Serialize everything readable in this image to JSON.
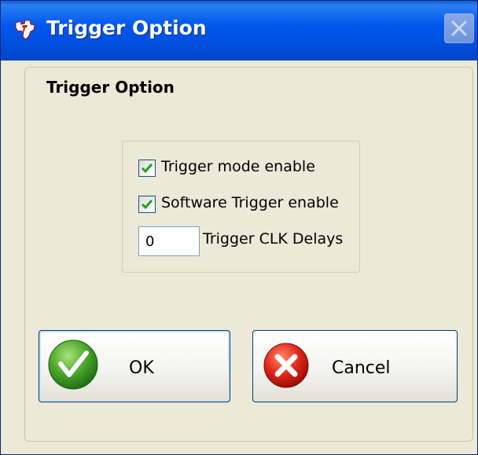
{
  "window": {
    "title": "Trigger Option",
    "icons": {
      "app": "texas-instruments-logo-icon",
      "close": "close-icon"
    },
    "colors": {
      "titlebar": "#0058ee",
      "body": "#ece9d8"
    }
  },
  "group": {
    "title": "Trigger Option"
  },
  "options": {
    "trigger_mode": {
      "label": "Trigger mode enable",
      "checked": true
    },
    "software_trigger": {
      "label": "Software Trigger enable",
      "checked": true
    },
    "clk_delays": {
      "label": "Trigger CLK Delays",
      "value": "0"
    }
  },
  "buttons": {
    "ok": {
      "label": "OK",
      "icon": "green-check-icon"
    },
    "cancel": {
      "label": "Cancel",
      "icon": "red-x-icon"
    }
  }
}
